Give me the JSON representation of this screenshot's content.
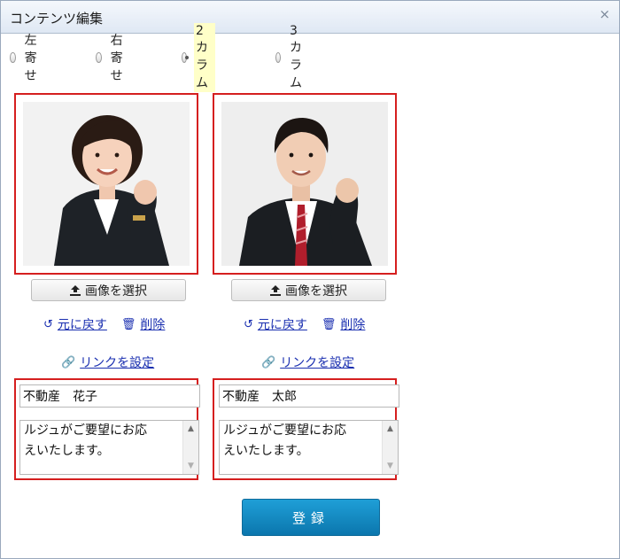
{
  "dialog": {
    "title": "コンテンツ編集",
    "close_glyph": "×"
  },
  "layout_options": [
    {
      "label": "左寄せ",
      "checked": false
    },
    {
      "label": "右寄せ",
      "checked": false
    },
    {
      "label": "2カラム",
      "checked": true
    },
    {
      "label": "3カラム",
      "checked": false
    }
  ],
  "columns": [
    {
      "select_image": "画像を選択",
      "revert": "元に戻す",
      "delete": "削除",
      "set_link": "リンクを設定",
      "name": "不動産　花子",
      "text_lines": [
        "ルジュがご要望にお応",
        "えいたします。"
      ]
    },
    {
      "select_image": "画像を選択",
      "revert": "元に戻す",
      "delete": "削除",
      "set_link": "リンクを設定",
      "name": "不動産　太郎",
      "text_lines": [
        "ルジュがご要望にお応",
        "えいたします。"
      ]
    }
  ],
  "submit_label": "登録",
  "colors": {
    "highlight_frame": "#d51f1f",
    "link": "#1a2fb0",
    "submit": "#1a8cc4"
  }
}
